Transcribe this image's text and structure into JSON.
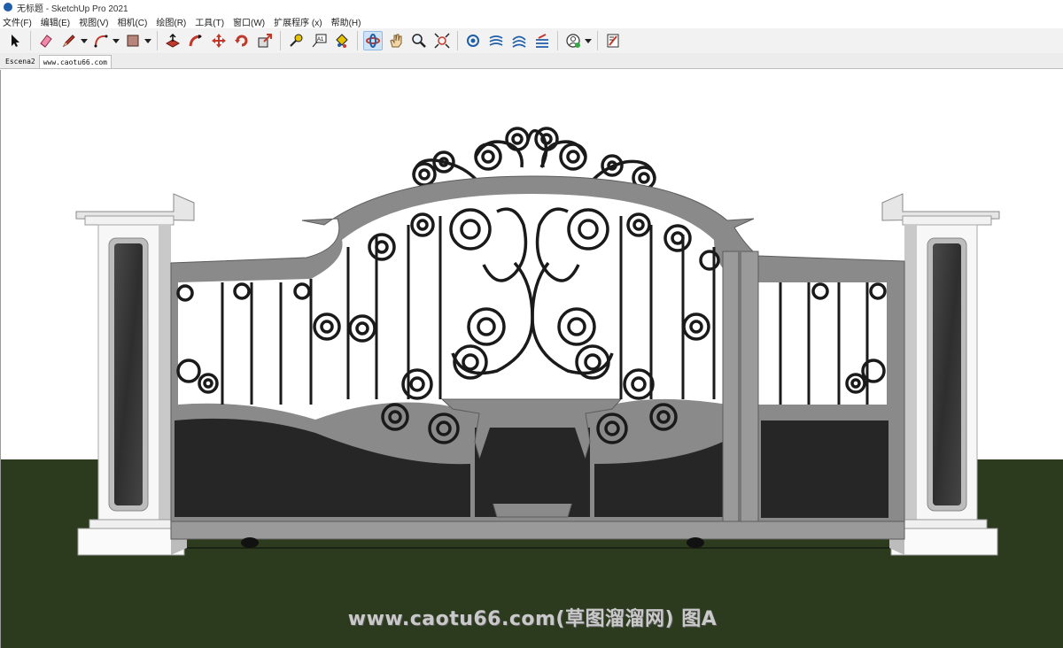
{
  "window": {
    "title": "无标题 - SketchUp Pro 2021"
  },
  "menu": {
    "items": [
      "文件(F)",
      "编辑(E)",
      "视图(V)",
      "相机(C)",
      "绘图(R)",
      "工具(T)",
      "窗口(W)",
      "扩展程序 (x)",
      "帮助(H)"
    ]
  },
  "toolbar": {
    "tools": [
      "select",
      "eraser",
      "pencil",
      "arc",
      "rectangle",
      "push-pull",
      "follow-me",
      "move",
      "rotate",
      "scale",
      "tape-measure",
      "text",
      "paint-bucket",
      "orbit",
      "pan",
      "zoom",
      "zoom-extents",
      "geo-location",
      "sandbox-from-contours",
      "sandbox-smoove",
      "sandbox-stamp",
      "account",
      "extension-warehouse"
    ]
  },
  "scenes": {
    "tabs": [
      "Escena2",
      "www.caotu66.com"
    ],
    "active_index": 1
  },
  "viewport": {
    "watermark": "www.caotu66.com(草图溜溜网) 图A",
    "colors": {
      "sky": "#ffffff",
      "ground": "#2c3a1e",
      "frame": "#8a8a8a",
      "panel": "#262626",
      "iron": "#1a1a1a",
      "pillar": "#f4f4f4",
      "granite": "#3a3a3a"
    }
  }
}
